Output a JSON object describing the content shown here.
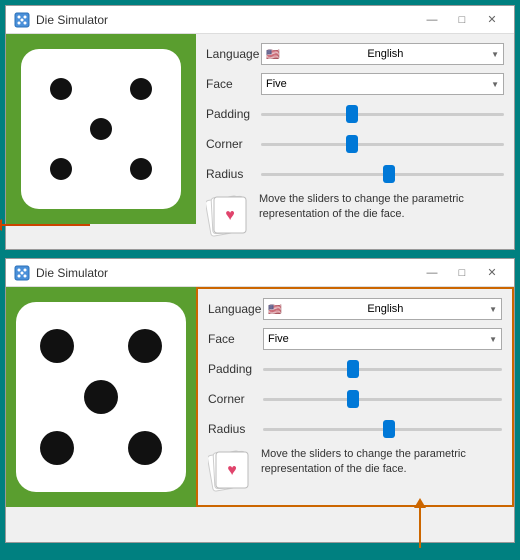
{
  "app": {
    "title": "Die Simulator",
    "titlebar_buttons": {
      "minimize": "—",
      "maximize": "□",
      "close": "✕"
    }
  },
  "top_window": {
    "title": "Die Simulator",
    "controls": {
      "language_label": "Language",
      "language_value": "English",
      "face_label": "Face",
      "face_value": "Five",
      "padding_label": "Padding",
      "corner_label": "Corner",
      "radius_label": "Radius"
    },
    "info_text": "Move the sliders to change the parametric representation of the die face.",
    "padding_thumb_pos": "35%",
    "corner_thumb_pos": "35%",
    "radius_thumb_pos": "50%"
  },
  "bottom_window": {
    "title": "Die Simulator",
    "controls": {
      "language_label": "Language",
      "language_value": "English",
      "face_label": "Face",
      "face_value": "Five",
      "padding_label": "Padding",
      "corner_label": "Corner",
      "radius_label": "Radius"
    },
    "info_text": "Move the sliders to change the parametric representation of the die face.",
    "padding_thumb_pos": "35%",
    "corner_thumb_pos": "35%",
    "radius_thumb_pos": "50%"
  }
}
